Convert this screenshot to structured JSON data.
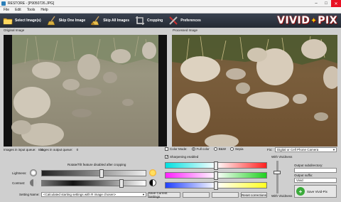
{
  "window": {
    "title": "RESTORE - [P9050726.JPG]"
  },
  "menu": [
    "File",
    "Edit",
    "Tools",
    "Help"
  ],
  "toolbar": {
    "buttons": [
      {
        "label": "Select Image(s)",
        "icon": "folder-icon"
      },
      {
        "label": "Skip One Image",
        "icon": "broom-icon"
      },
      {
        "label": "Skip All Images",
        "icon": "broom-all-icon"
      },
      {
        "label": "Cropping",
        "icon": "crop-icon"
      },
      {
        "label": "Preferences",
        "icon": "tools-icon"
      }
    ],
    "logo": {
      "part1": "VIVID",
      "part2": "PIX"
    }
  },
  "panels": {
    "original": "Original Image",
    "processed": "Processed Image"
  },
  "queue": {
    "input_label": "Images in input queue:",
    "input_count": "10",
    "output_label": "Images in output queue:",
    "output_count": "0"
  },
  "color_mode": {
    "label": "Color Mode:",
    "options": [
      "Full color",
      "B&W",
      "Sepia"
    ],
    "selected": "Full color",
    "fix_label": "Fix:",
    "fix_value": "Digital or Cell Phone Camera"
  },
  "sharpening": {
    "label": "Sharpening enabled",
    "checked": true
  },
  "rotate_note": "Rotate/Tilt feature disabled after cropping",
  "lightness_label": "Lightness:",
  "contrast_label": "Contrast:",
  "lightness_level": 0.58,
  "contrast_level": 0.78,
  "color_bars": [
    {
      "name": "cyan-red",
      "left": "#00e0e0",
      "right": "#ff2020",
      "level": 0.5
    },
    {
      "name": "magenta-green",
      "left": "#ff20ff",
      "right": "#20d020",
      "level": 0.5
    },
    {
      "name": "blue-yellow",
      "left": "#2040ff",
      "right": "#ffff20",
      "level": 0.5
    }
  ],
  "setting_name": {
    "label": "Setting Name:",
    "value": "<Calculated starting settings with R image chosen>"
  },
  "buttons": {
    "save_settings": "Save Current Settings",
    "reset": "Reset corrections",
    "undo": "",
    "redo": ""
  },
  "vividness": {
    "top_label": "With Vividness",
    "bottom_label": "With Vividness",
    "level": 0.35
  },
  "output": {
    "subdir_label": "Output subdirectory:",
    "subdir_value": "",
    "suffix_label": "Output suffix:",
    "suffix_value": "Vivid",
    "save_button": "Save Vivid-Pix"
  }
}
